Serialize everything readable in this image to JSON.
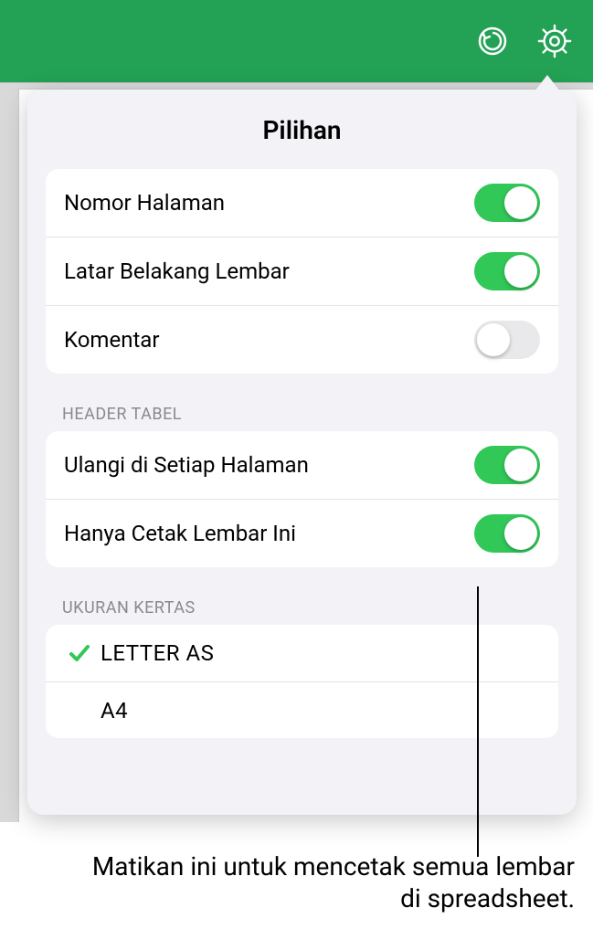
{
  "toolbar": {
    "undo_icon": "undo-icon",
    "settings_icon": "gear-icon"
  },
  "popover": {
    "title": "Pilihan",
    "group1": {
      "page_numbers": {
        "label": "Nomor Halaman",
        "on": true
      },
      "sheet_background": {
        "label": "Latar Belakang Lembar",
        "on": true
      },
      "comments": {
        "label": "Komentar",
        "on": false
      }
    },
    "group2": {
      "header": "HEADER TABEL",
      "repeat_each_page": {
        "label": "Ulangi di Setiap Halaman",
        "on": true
      },
      "print_this_sheet_only": {
        "label": "Hanya Cetak Lembar Ini",
        "on": true
      }
    },
    "group3": {
      "header": "UKURAN KERTAS",
      "letter": {
        "label": "LETTER AS",
        "selected": true
      },
      "a4": {
        "label": "A4",
        "selected": false
      }
    }
  },
  "caption": "Matikan ini untuk mencetak semua lembar di spreadsheet."
}
